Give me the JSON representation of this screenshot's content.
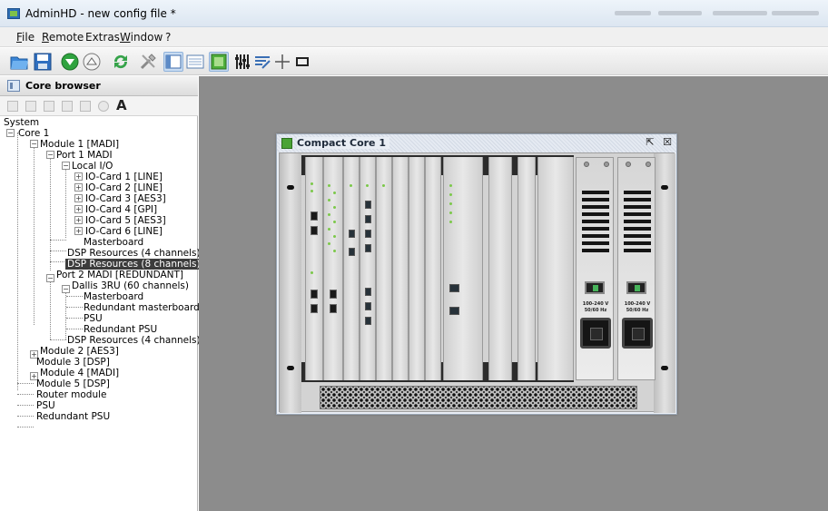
{
  "window": {
    "title": "AdminHD - new config file *"
  },
  "menu": [
    {
      "label": "File",
      "u": "F",
      "rest": "ile"
    },
    {
      "label": "Remote",
      "u": "R",
      "rest": "emote"
    },
    {
      "label": "Extras",
      "u": "",
      "rest": "Extras"
    },
    {
      "label": "Window",
      "u": "W",
      "rest": "indow"
    },
    {
      "label": "?",
      "u": "",
      "rest": "?"
    }
  ],
  "toolbar": {
    "icons": [
      "open-folder-icon",
      "save-icon",
      "download-icon",
      "upload-icon",
      "refresh-icon",
      "tools-icon",
      "core-browser-view-icon",
      "list-view-icon",
      "mixer-view-icon",
      "faders-icon",
      "routing-icon",
      "crosshair-icon",
      "monitor-icon"
    ]
  },
  "core_browser": {
    "title": "Core browser",
    "tools": [
      "collapse-icon",
      "expand-icon",
      "copy-icon",
      "paste-icon",
      "new-icon",
      "disable-icon",
      "font-icon"
    ],
    "font_tool_label": "A"
  },
  "tree": [
    {
      "label": "System"
    },
    {
      "label": "Core 1"
    },
    {
      "label": "Module 1 [MADI]"
    },
    {
      "label": "Port 1 MADI"
    },
    {
      "label": "Local I/O"
    },
    {
      "label": "IO-Card 1 [LINE]"
    },
    {
      "label": "IO-Card 2 [LINE]"
    },
    {
      "label": "IO-Card 3 [AES3]"
    },
    {
      "label": "IO-Card 4 [GPI]"
    },
    {
      "label": "IO-Card 5 [AES3]"
    },
    {
      "label": "IO-Card 6 [LINE]"
    },
    {
      "label": "Masterboard"
    },
    {
      "label": "DSP Resources (4 channels)"
    },
    {
      "label": "DSP Resources (8 channels)"
    },
    {
      "label": "Port 2 MADI [REDUNDANT]"
    },
    {
      "label": "Dallis 3RU (60 channels)"
    },
    {
      "label": "Masterboard"
    },
    {
      "label": "Redundant masterboard"
    },
    {
      "label": "PSU"
    },
    {
      "label": "Redundant PSU"
    },
    {
      "label": "DSP Resources (4 channels)"
    },
    {
      "label": "Module 2 [AES3]"
    },
    {
      "label": "Module 3 [DSP]"
    },
    {
      "label": "Module 4 [MADI]"
    },
    {
      "label": "Module 5 [DSP]"
    },
    {
      "label": "Router module"
    },
    {
      "label": "PSU"
    },
    {
      "label": "Redundant PSU"
    }
  ],
  "subwindow": {
    "title": "Compact Core 1",
    "restore_label": "⇱",
    "close_label": "☒",
    "psu_voltage": "100-240 V",
    "psu_freq": "50/60 Hz"
  },
  "colors": {
    "workspace": "#8c8c8c",
    "selection": "#3c3c3c",
    "led_green": "#7cc84a"
  }
}
